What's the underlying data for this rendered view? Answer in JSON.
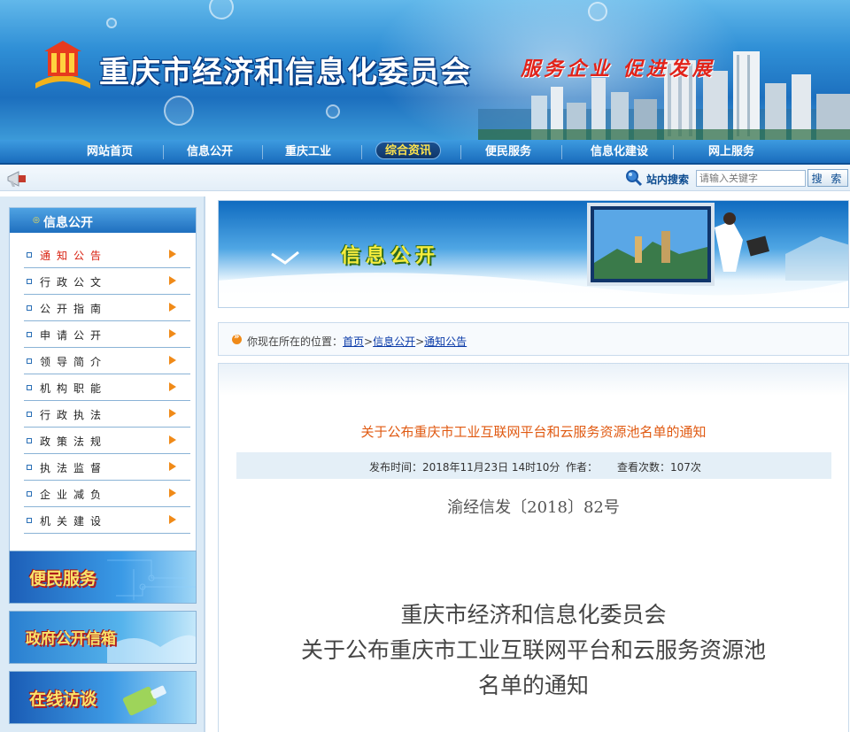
{
  "header": {
    "site_title": "重庆市经济和信息化委员会",
    "slogan": "服务企业  促进发展"
  },
  "nav": {
    "items": [
      {
        "label": "网站首页",
        "active": false
      },
      {
        "label": "信息公开",
        "active": false
      },
      {
        "label": "重庆工业",
        "active": false
      },
      {
        "label": "综合资讯",
        "active": true
      },
      {
        "label": "便民服务",
        "active": false
      },
      {
        "label": "信息化建设",
        "active": false
      },
      {
        "label": "网上服务",
        "active": false
      }
    ]
  },
  "search": {
    "label": "站内搜索",
    "placeholder": "请输入关键字",
    "button": "搜 索"
  },
  "sidebar": {
    "title": "信息公开",
    "items": [
      {
        "label": "通知公告",
        "current": true
      },
      {
        "label": "行政公文",
        "current": false
      },
      {
        "label": "公开指南",
        "current": false
      },
      {
        "label": "申请公开",
        "current": false
      },
      {
        "label": "领导简介",
        "current": false
      },
      {
        "label": "机构职能",
        "current": false
      },
      {
        "label": "行政执法",
        "current": false
      },
      {
        "label": "政策法规",
        "current": false
      },
      {
        "label": "执法监督",
        "current": false
      },
      {
        "label": "企业减负",
        "current": false
      },
      {
        "label": "机关建设",
        "current": false
      }
    ],
    "promos": [
      {
        "label": "便民服务"
      },
      {
        "label": "政府公开信箱"
      },
      {
        "label": "在线访谈"
      }
    ]
  },
  "banner": {
    "title": "信息公开"
  },
  "breadcrumb": {
    "prefix": "你现在所在的位置：",
    "links": [
      "首页",
      "信息公开",
      "通知公告"
    ],
    "separator": ">"
  },
  "article": {
    "title": "关于公布重庆市工业互联网平台和云服务资源池名单的通知",
    "published_label": "发布时间：2018年11月23日 14时10分",
    "author_label": "作者：",
    "views_label": "查看次数：107次",
    "doc_number": "渝经信发〔2018〕82号",
    "heading_lines": [
      "重庆市经济和信息化委员会",
      "关于公布重庆市工业互联网平台和云服务资源池",
      "名单的通知"
    ]
  },
  "colors": {
    "nav_blue": "#1a6cbc",
    "slogan_red": "#e2231a",
    "article_title_orange": "#e05a12",
    "link_blue": "#0a3aa8"
  }
}
